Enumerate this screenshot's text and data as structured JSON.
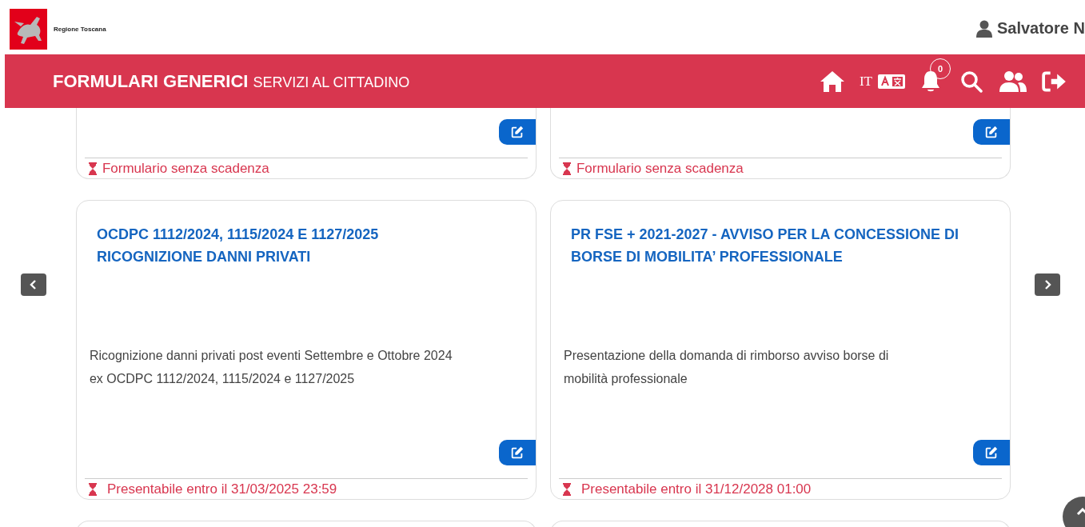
{
  "header": {
    "logo_text": "Regione Toscana",
    "user_name": "Salvatore N"
  },
  "navbar": {
    "title": "FORMULARI GENERICI",
    "subtitle": "SERVIZI AL CITTADINO",
    "language": "IT",
    "notifications": "0"
  },
  "rows": [
    {
      "kind": "partial",
      "cards": [
        {
          "deadline": "Formulario senza scadenza"
        },
        {
          "deadline": "Formulario senza scadenza"
        }
      ]
    },
    {
      "kind": "full",
      "cards": [
        {
          "title": "OCDPC 1112/2024, 1115/2024 E 1127/2025 RICOGNIZIONE DANNI PRIVATI",
          "description": "Ricognizione danni privati post eventi Settembre e Ottobre 2024 ex OCDPC 1112/2024, 1115/2024 e 1127/2025",
          "deadline": "Presentabile entro il 31/03/2025 23:59"
        },
        {
          "title": "PR FSE + 2021-2027 - AVVISO PER LA CONCESSIONE DI BORSE DI MOBILITA’ PROFESSIONALE",
          "description": "Presentazione della domanda di rimborso avviso borse di mobilità professionale",
          "deadline": "Presentabile entro il 31/12/2028 01:00"
        }
      ]
    }
  ]
}
